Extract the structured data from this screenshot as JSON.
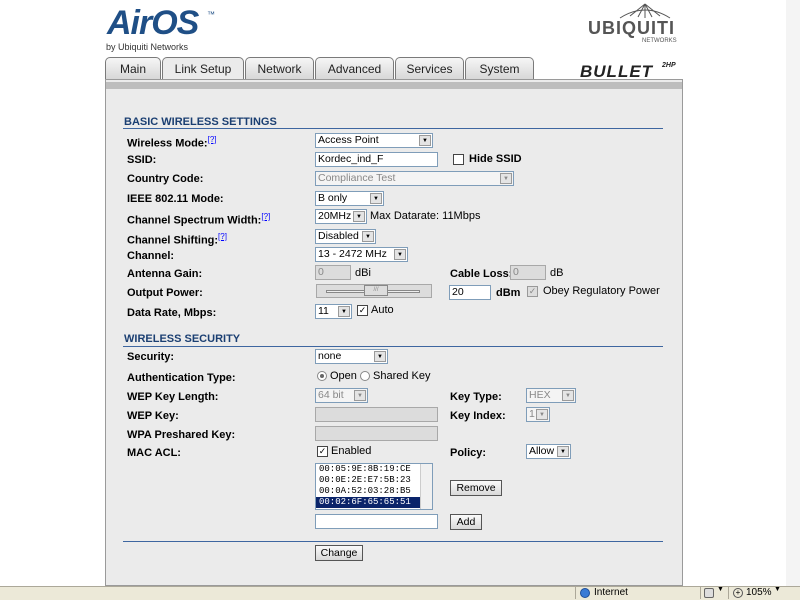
{
  "header": {
    "airos_logo": "AirOS",
    "airos_tm": "™",
    "airos_sub": "by Ubiquiti Networks",
    "vendor_logo": "UBIQUITI",
    "vendor_sub": "NETWORKS",
    "device_logo": "BULLET",
    "device_sup": "2HP"
  },
  "tabs": [
    "Main",
    "Link Setup",
    "Network",
    "Advanced",
    "Services",
    "System"
  ],
  "active_tab": "Link Setup",
  "basic": {
    "title": "BASIC WIRELESS SETTINGS",
    "wireless_mode_label": "Wireless Mode:",
    "help": "[?]",
    "wireless_mode": "Access Point",
    "ssid_label": "SSID:",
    "ssid": "Kordec_ind_F",
    "hide_ssid": "Hide SSID",
    "country_label": "Country Code:",
    "country": "Compliance Test",
    "ieee_label": "IEEE 802.11 Mode:",
    "ieee": "B only",
    "spectrum_label": "Channel Spectrum Width:",
    "spectrum": "20MHz",
    "max_datarate": "Max Datarate: 11Mbps",
    "shifting_label": "Channel Shifting:",
    "shifting": "Disabled",
    "channel_label": "Channel:",
    "channel": "13 - 2472 MHz",
    "gain_label": "Antenna Gain:",
    "gain": "0",
    "dbi": "dBi",
    "cable_label": "Cable Loss:",
    "cable": "0",
    "db": "dB",
    "power_label": "Output Power:",
    "power": "20",
    "dbm": "dBm",
    "obey": "Obey Regulatory Power",
    "rate_label": "Data Rate, Mbps:",
    "rate": "11",
    "auto": "Auto"
  },
  "security": {
    "title": "WIRELESS SECURITY",
    "security_label": "Security:",
    "security": "none",
    "auth_label": "Authentication Type:",
    "auth_open": "Open",
    "auth_shared": "Shared Key",
    "wep_len_label": "WEP Key Length:",
    "wep_len": "64 bit",
    "key_type_label": "Key Type:",
    "key_type": "HEX",
    "wep_key_label": "WEP Key:",
    "key_index_label": "Key Index:",
    "key_index": "1",
    "wpa_label": "WPA Preshared Key:",
    "mac_acl_label": "MAC ACL:",
    "enabled": "Enabled",
    "policy_label": "Policy:",
    "policy": "Allow",
    "mac_list": [
      "00:05:9E:8B:19:CE",
      "00:0E:2E:E7:5B:23",
      "00:0A:52:03:28:B5",
      "00:02:6F:65:65:51"
    ],
    "remove": "Remove",
    "add": "Add"
  },
  "change": "Change",
  "statusbar": {
    "zone": "Internet",
    "zoom": "105%"
  }
}
